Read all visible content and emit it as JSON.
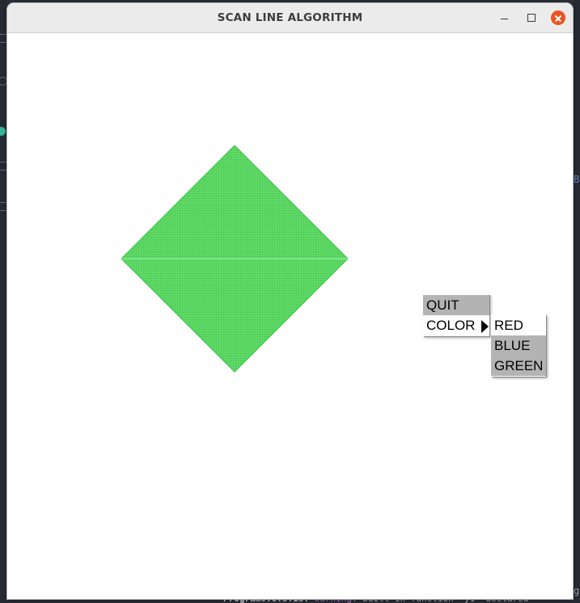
{
  "window": {
    "title": "SCAN LINE ALGORITHM"
  },
  "canvas": {
    "shape": "diamond",
    "fill_color": "#62dc6a",
    "grid_color": "#3fbf49"
  },
  "menu": {
    "items": [
      {
        "label": "QUIT",
        "highlighted": true
      },
      {
        "label": "COLOR",
        "highlighted": false,
        "has_submenu": true
      }
    ]
  },
  "submenu": {
    "items": [
      {
        "label": "RED",
        "highlighted": false
      },
      {
        "label": "BLUE",
        "highlighted": true
      },
      {
        "label": "GREEN",
        "highlighted": true
      }
    ]
  },
  "background": {
    "terminal_line": {
      "file": "Program9.c:5:13:",
      "level": "warning:",
      "message": "built-in function 'y1' declared"
    },
    "right_glyph": "B",
    "right_glyph_bottom": "g"
  },
  "colors": {
    "close_button": "#e95420",
    "menu_highlight": "#b3b3b3"
  }
}
